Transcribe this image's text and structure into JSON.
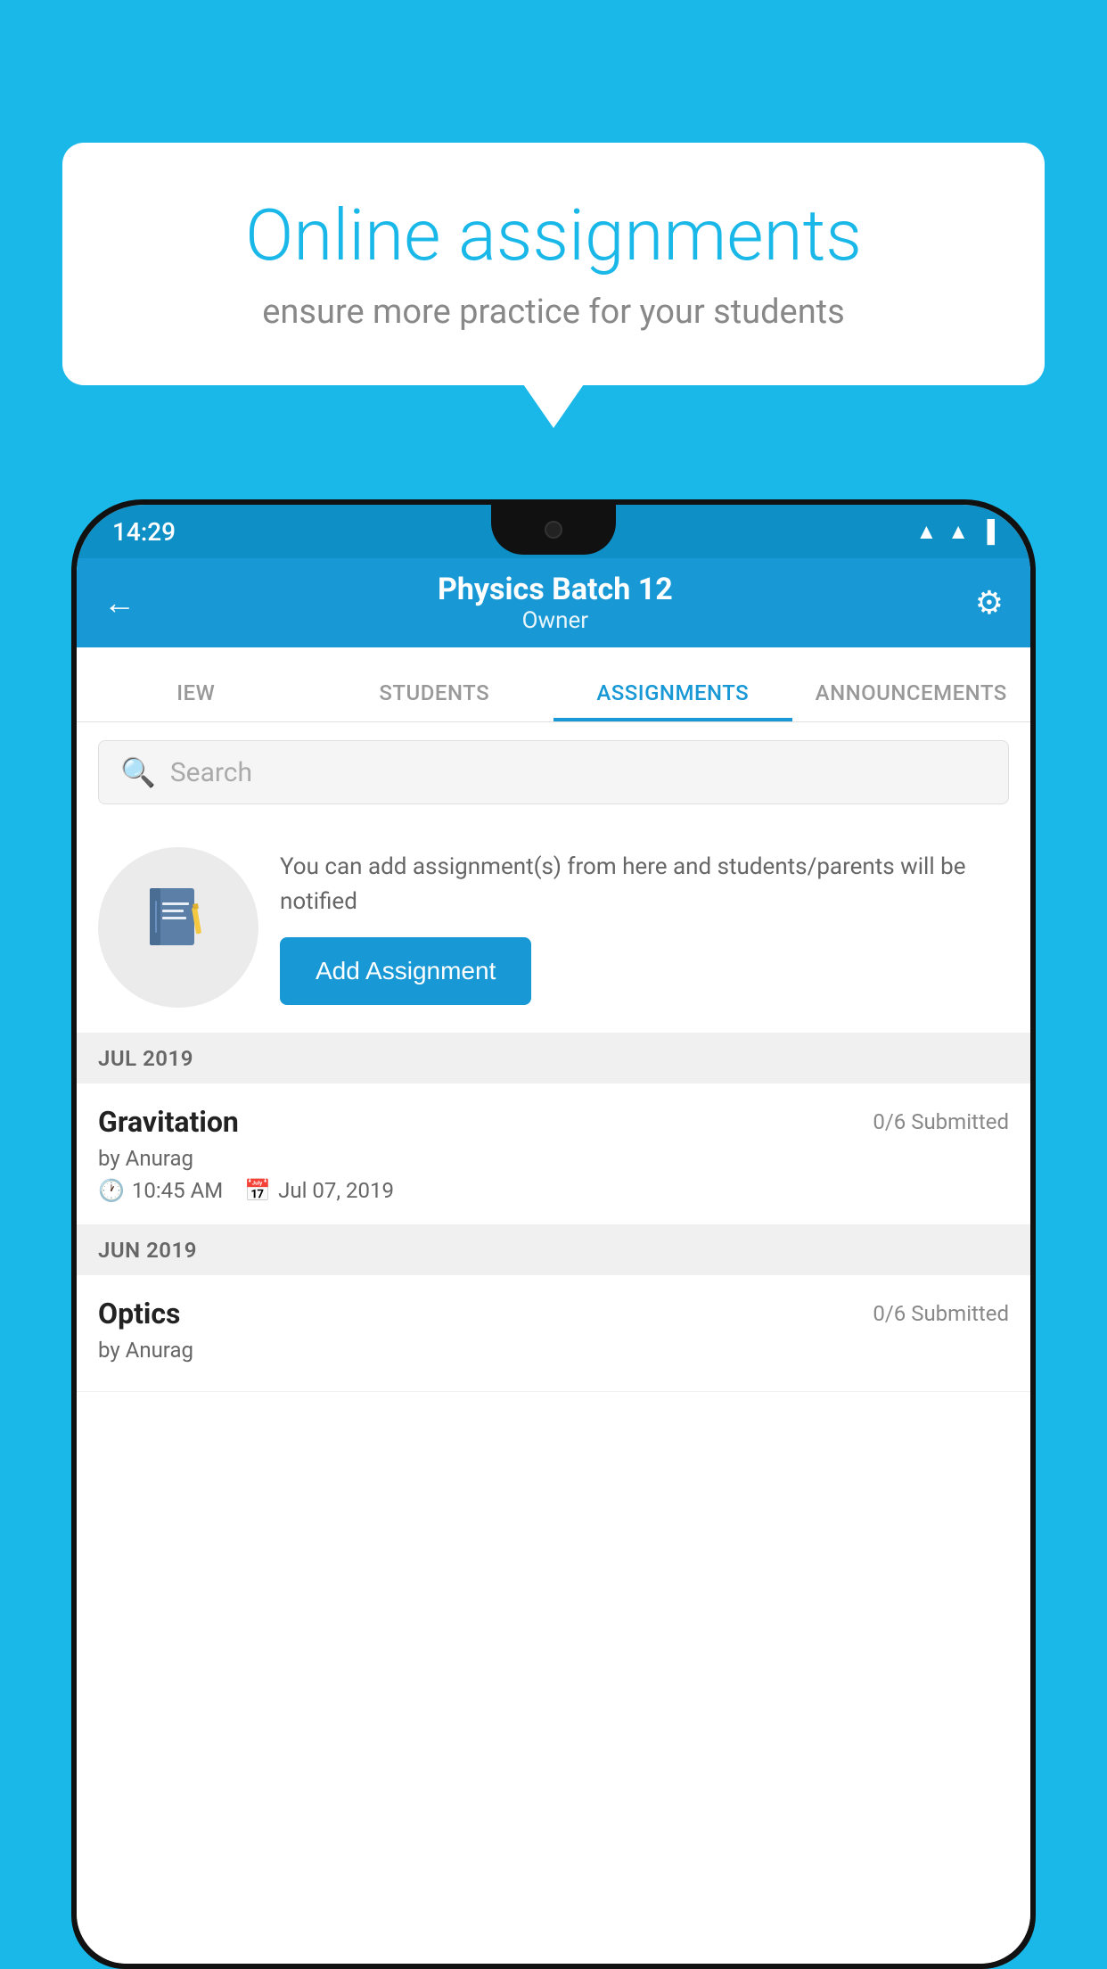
{
  "background_color": "#1ab8e8",
  "speech_bubble": {
    "title": "Online assignments",
    "subtitle": "ensure more practice for your students"
  },
  "phone": {
    "status_bar": {
      "time": "14:29",
      "icons": [
        "wifi",
        "signal",
        "battery"
      ]
    },
    "app_bar": {
      "title": "Physics Batch 12",
      "subtitle": "Owner",
      "back_label": "←",
      "settings_label": "⚙"
    },
    "tabs": [
      {
        "label": "IEW",
        "active": false
      },
      {
        "label": "STUDENTS",
        "active": false
      },
      {
        "label": "ASSIGNMENTS",
        "active": true
      },
      {
        "label": "ANNOUNCEMENTS",
        "active": false
      }
    ],
    "search": {
      "placeholder": "Search"
    },
    "promo": {
      "icon": "📓",
      "text": "You can add assignment(s) from here and students/parents will be notified",
      "button_label": "Add Assignment"
    },
    "sections": [
      {
        "label": "JUL 2019",
        "assignments": [
          {
            "name": "Gravitation",
            "submitted": "0/6 Submitted",
            "by": "by Anurag",
            "time": "10:45 AM",
            "date": "Jul 07, 2019"
          }
        ]
      },
      {
        "label": "JUN 2019",
        "assignments": [
          {
            "name": "Optics",
            "submitted": "0/6 Submitted",
            "by": "by Anurag",
            "time": "",
            "date": ""
          }
        ]
      }
    ]
  }
}
